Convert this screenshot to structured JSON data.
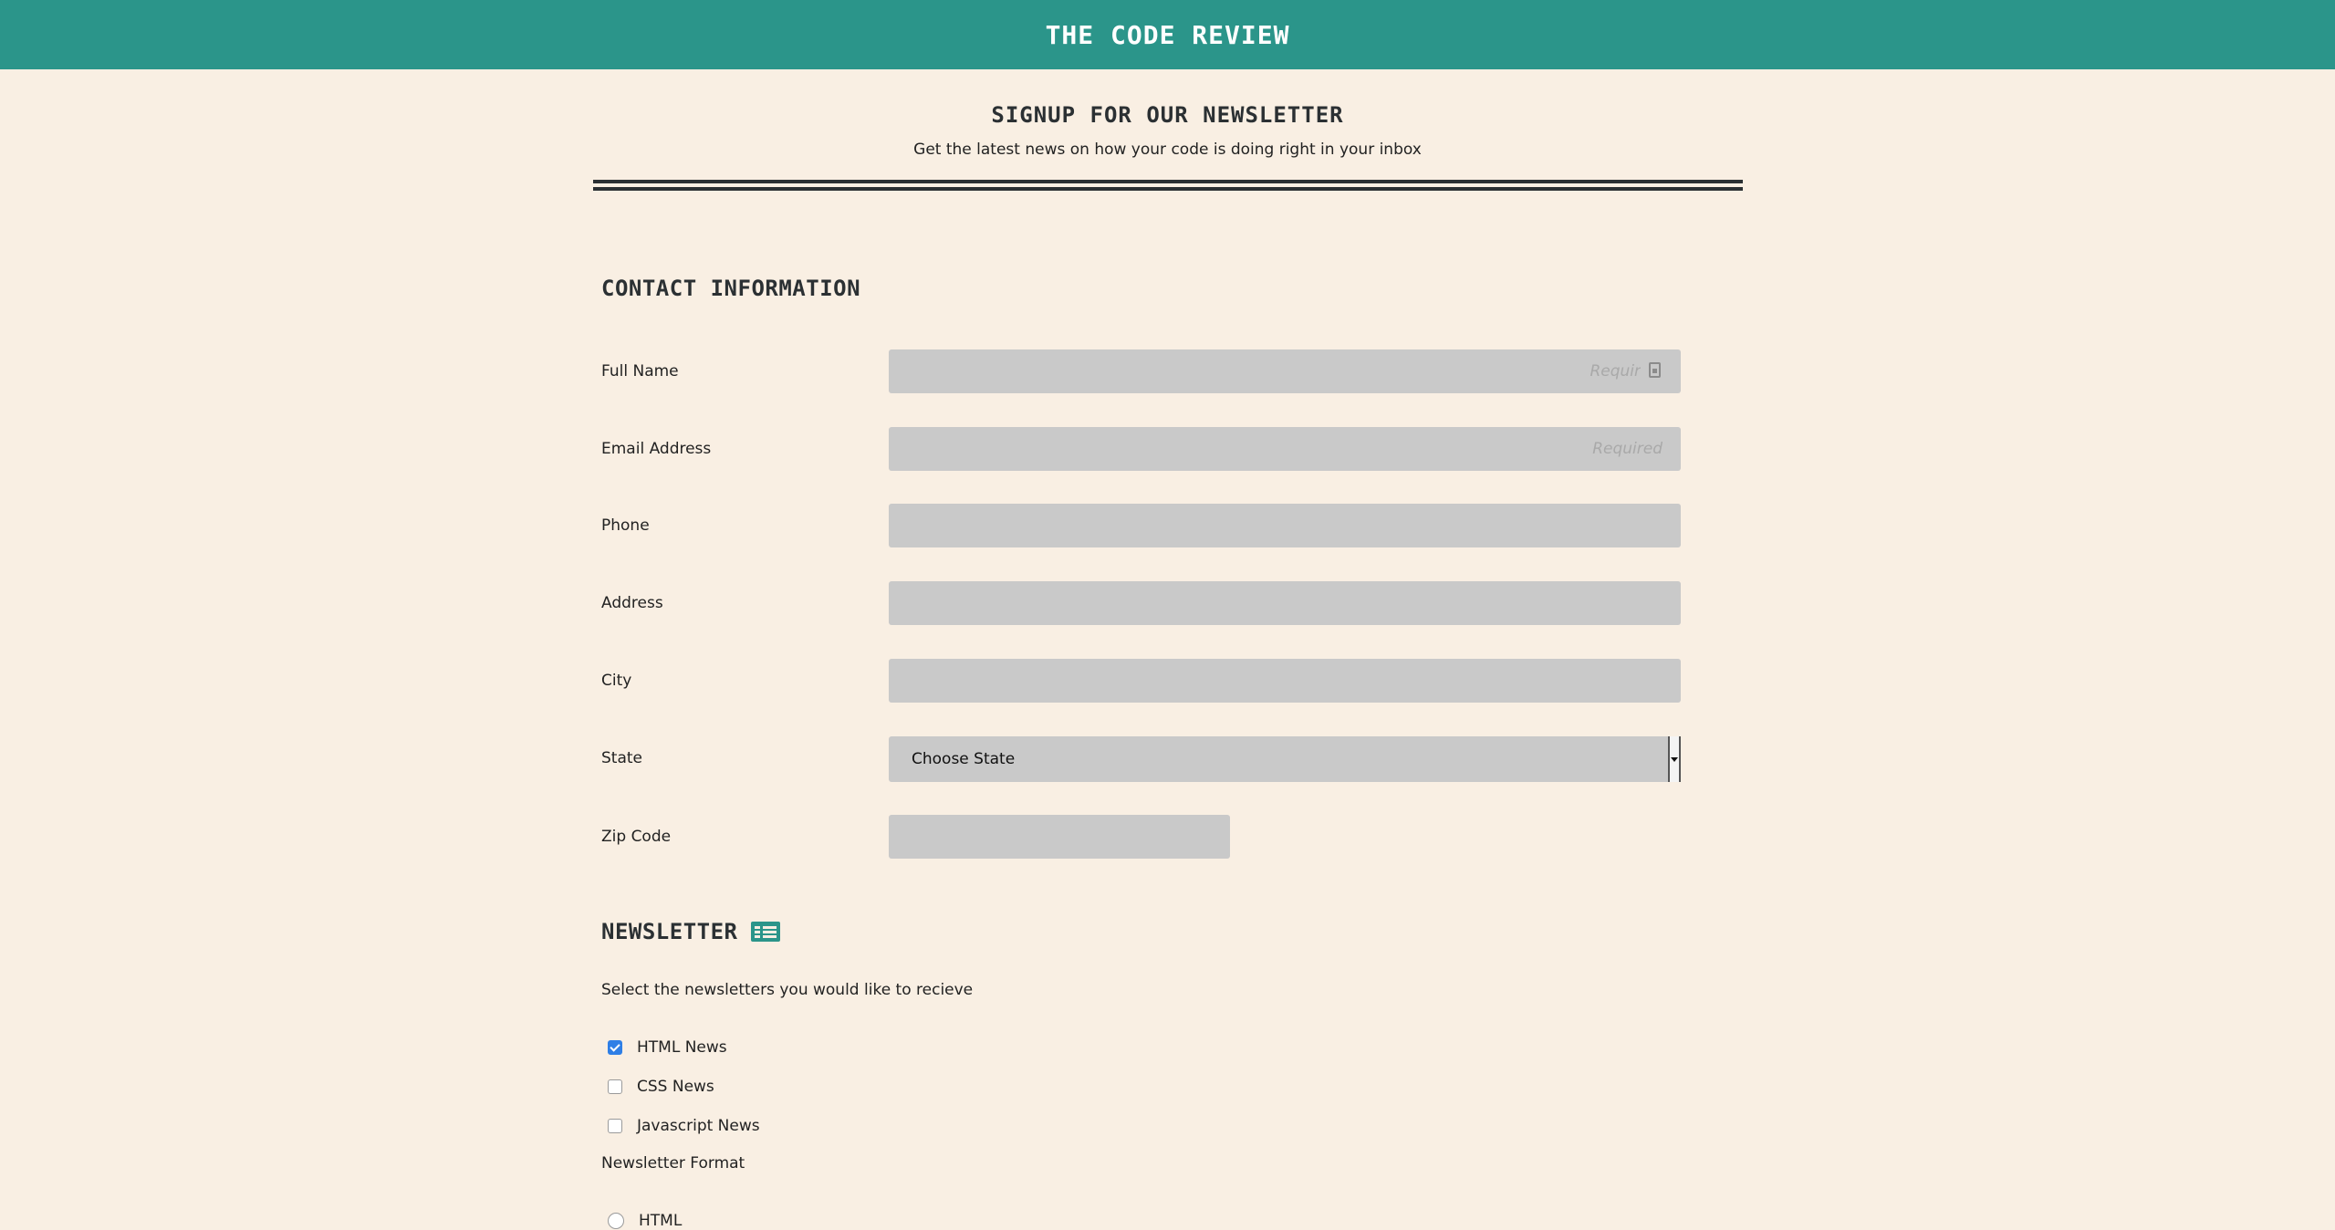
{
  "header": {
    "site_title": "THE CODE REVIEW"
  },
  "intro": {
    "title": "SIGNUP FOR OUR NEWSLETTER",
    "subtitle": "Get the latest news on how your code is doing right in your inbox"
  },
  "contact": {
    "heading": "CONTACT INFORMATION",
    "full_name": {
      "label": "Full Name",
      "placeholder": "Requir",
      "value": ""
    },
    "email": {
      "label": "Email Address",
      "placeholder": "Required",
      "value": ""
    },
    "phone": {
      "label": "Phone",
      "placeholder": "",
      "value": ""
    },
    "address": {
      "label": "Address",
      "placeholder": "",
      "value": ""
    },
    "city": {
      "label": "City",
      "placeholder": "",
      "value": ""
    },
    "state": {
      "label": "State",
      "selected": "Choose State"
    },
    "zip": {
      "label": "Zip Code",
      "placeholder": "",
      "value": ""
    }
  },
  "newsletter": {
    "heading": "NEWSLETTER",
    "icon": "newspaper-icon",
    "instruction": "Select the newsletters you would like to recieve",
    "options": [
      {
        "label": "HTML News",
        "checked": true
      },
      {
        "label": "CSS News",
        "checked": false
      },
      {
        "label": "Javascript News",
        "checked": false
      }
    ],
    "format_label": "Newsletter Format",
    "formats": [
      {
        "label": "HTML",
        "selected": false
      }
    ]
  },
  "colors": {
    "header_bg": "#2b958a",
    "page_bg": "#f9efe3",
    "input_bg": "#c9c9c9",
    "checkbox_checked": "#2f7fe6"
  }
}
